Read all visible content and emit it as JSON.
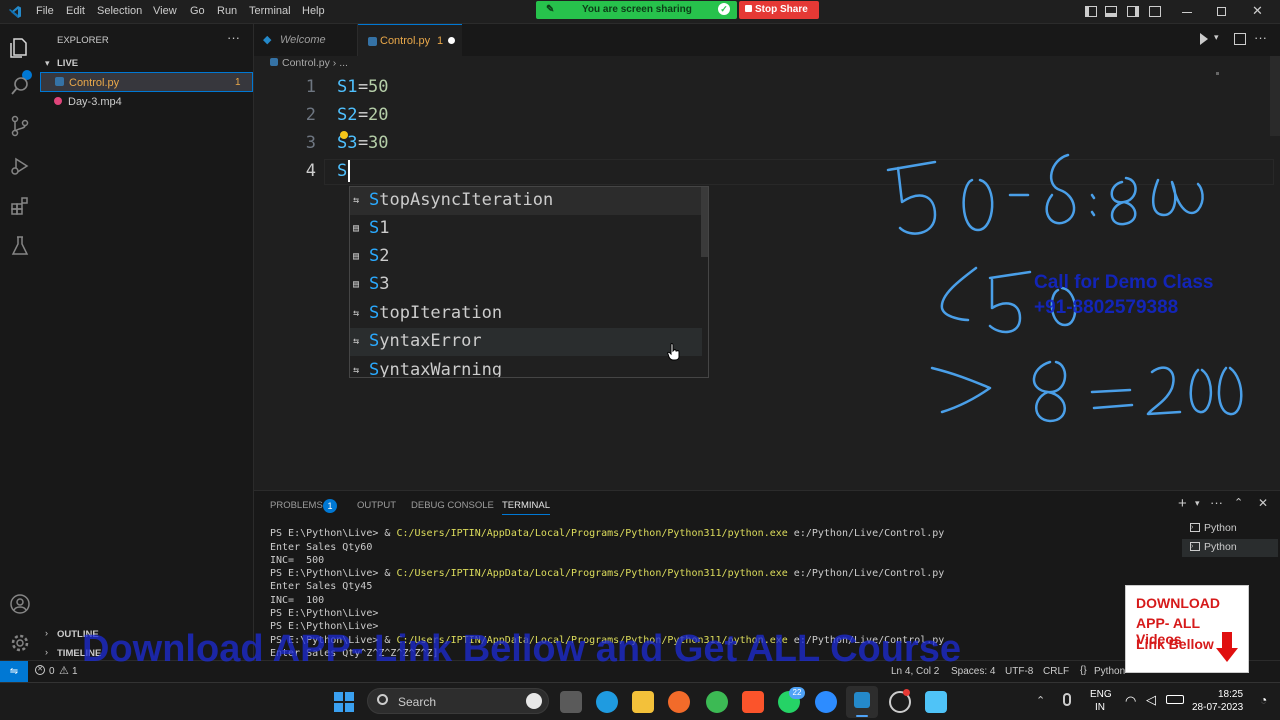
{
  "titlebar": {
    "menu": [
      "File",
      "Edit",
      "Selection",
      "View",
      "Go",
      "Run",
      "Terminal",
      "Help"
    ],
    "share_banner": "You are screen sharing",
    "stop_share": "Stop Share"
  },
  "sidebar": {
    "title": "EXPLORER",
    "folder": "LIVE",
    "files": [
      {
        "name": "Control.py",
        "badge": "1"
      },
      {
        "name": "Day-3.mp4",
        "badge": ""
      }
    ],
    "outline": "OUTLINE",
    "timeline": "TIMELINE"
  },
  "tabs": [
    {
      "label": "Welcome"
    },
    {
      "label": "Control.py",
      "badge": "1"
    }
  ],
  "breadcrumb": {
    "file": "Control.py",
    "more": "..."
  },
  "editor": {
    "lines": [
      {
        "num": "1",
        "var": "S1",
        "op": "=",
        "val": "50"
      },
      {
        "num": "2",
        "var": "S2",
        "op": "=",
        "val": "20"
      },
      {
        "num": "3",
        "var": "S3",
        "op": "=",
        "val": "30"
      },
      {
        "num": "4",
        "var": "S",
        "op": "",
        "val": ""
      }
    ]
  },
  "suggest": {
    "items": [
      {
        "first": "S",
        "rest": "topAsyncIteration",
        "kind": "class"
      },
      {
        "first": "S",
        "rest": "1",
        "kind": "variable"
      },
      {
        "first": "S",
        "rest": "2",
        "kind": "variable"
      },
      {
        "first": "S",
        "rest": "3",
        "kind": "variable"
      },
      {
        "first": "S",
        "rest": "topIteration",
        "kind": "class"
      },
      {
        "first": "S",
        "rest": "yntaxError",
        "kind": "class"
      },
      {
        "first": "S",
        "rest": "yntaxWarning",
        "kind": "class"
      }
    ]
  },
  "panel": {
    "tabs": [
      "PROBLEMS",
      "OUTPUT",
      "DEBUG CONSOLE",
      "TERMINAL"
    ],
    "problems_count": "1",
    "terminals": [
      "Python",
      "Python"
    ],
    "terminal_lines": [
      {
        "prefix": "PS E:\\Python\\Live> & ",
        "cmd": "C:/Users/IPTIN/AppData/Local/Programs/Python/Python311/python.exe",
        "rest": " e:/Python/Live/Control.py"
      },
      {
        "prefix": "Enter Sales Qty60",
        "cmd": "",
        "rest": ""
      },
      {
        "prefix": "INC=  500",
        "cmd": "",
        "rest": ""
      },
      {
        "prefix": "PS E:\\Python\\Live> & ",
        "cmd": "C:/Users/IPTIN/AppData/Local/Programs/Python/Python311/python.exe",
        "rest": " e:/Python/Live/Control.py"
      },
      {
        "prefix": "Enter Sales Qty45",
        "cmd": "",
        "rest": ""
      },
      {
        "prefix": "INC=  100",
        "cmd": "",
        "rest": ""
      },
      {
        "prefix": "PS E:\\Python\\Live>",
        "cmd": "",
        "rest": ""
      },
      {
        "prefix": "PS E:\\Python\\Live>",
        "cmd": "",
        "rest": ""
      },
      {
        "prefix": "PS E:\\Python\\Live> & ",
        "cmd": "C:/Users/IPTIN/AppData/Local/Programs/Python/Python311/python.exe",
        "rest": " e:/Python/Live/Control.py"
      },
      {
        "prefix": "Enter Sales Qty^Z^Z^Z^Z^Z^Z]",
        "cmd": "",
        "rest": ""
      }
    ]
  },
  "statusbar": {
    "errors": "0",
    "warnings": "1",
    "position": "Ln 4, Col 2",
    "spaces": "Spaces: 4",
    "encoding": "UTF-8",
    "eol": "CRLF",
    "language": "Python"
  },
  "taskbar": {
    "search_placeholder": "Search",
    "lang": "ENG",
    "region": "IN",
    "time": "18:25",
    "date": "28-07-2023",
    "whatsapp_badge": "22"
  },
  "overlays": {
    "demo_line1": "Call for Demo Class",
    "demo_line2": "+91-8802579388",
    "watermark": "Download APP- Link Bellow and Get ALL Course",
    "promo_line1": "DOWNLOAD",
    "promo_line2": "APP- ALL Videos",
    "promo_line3": "Link Bellow"
  },
  "colors": {
    "accent": "#007acc",
    "variable": "#4fc1ff",
    "number": "#b5cea8",
    "handwriting": "#4a9fe8",
    "watermark": "#1c2bd6"
  }
}
